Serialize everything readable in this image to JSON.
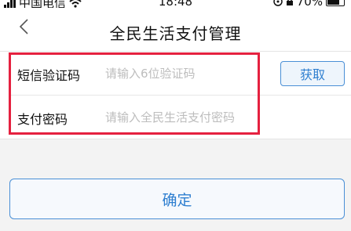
{
  "status_bar": {
    "carrier": "中国电信",
    "time": "18:48",
    "battery": "70%",
    "icons": [
      "signal-icon",
      "wifi-icon",
      "location-icon",
      "lock-icon",
      "battery-icon"
    ]
  },
  "nav": {
    "title": "全民生活支付管理",
    "back_icon": "chevron-left-icon"
  },
  "form": {
    "sms_code": {
      "label": "短信验证码",
      "placeholder": "请输入6位验证码",
      "value": "",
      "button_label": "获取"
    },
    "pay_password": {
      "label": "支付密码",
      "placeholder": "请输入全民生活支付密码",
      "value": ""
    }
  },
  "confirm_button": {
    "label": "确定"
  },
  "colors": {
    "accent": "#2f7fd0",
    "highlight": "#e5213f",
    "background": "#f3f3f3"
  }
}
